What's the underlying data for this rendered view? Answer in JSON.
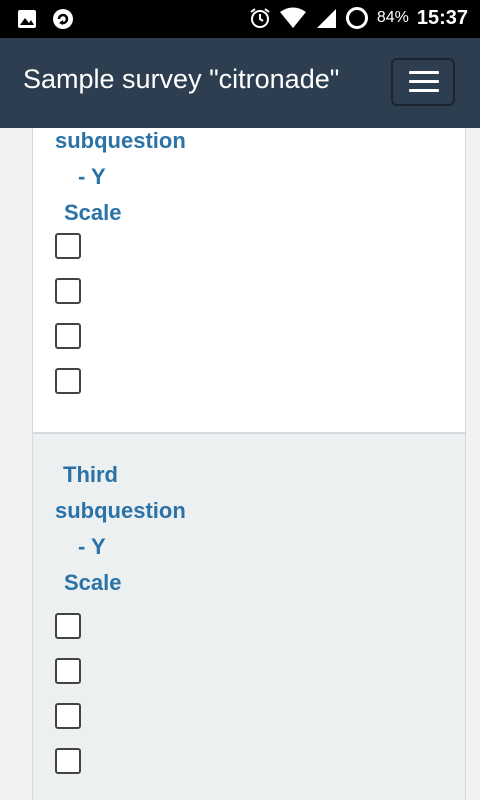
{
  "status_bar": {
    "battery": "84%",
    "time": "15:37",
    "icons": [
      "image-icon",
      "sync-icon",
      "alarm-icon",
      "wifi-icon",
      "signal-icon",
      "battery-icon"
    ]
  },
  "app_bar": {
    "title": "Sample survey \"citronade\"",
    "menu_icon": "hamburger-menu-icon"
  },
  "questions": [
    {
      "label_lines": [
        "subquestion",
        "- Y",
        "Scale"
      ],
      "checkbox_count": 4
    },
    {
      "label_lines": [
        "Third",
        "subquestion",
        "- Y",
        "Scale"
      ],
      "checkbox_count": 4
    }
  ],
  "colors": {
    "app_bar": "#2c3e50",
    "label": "#2b73a6",
    "card_grey": "#ecf0f1"
  }
}
